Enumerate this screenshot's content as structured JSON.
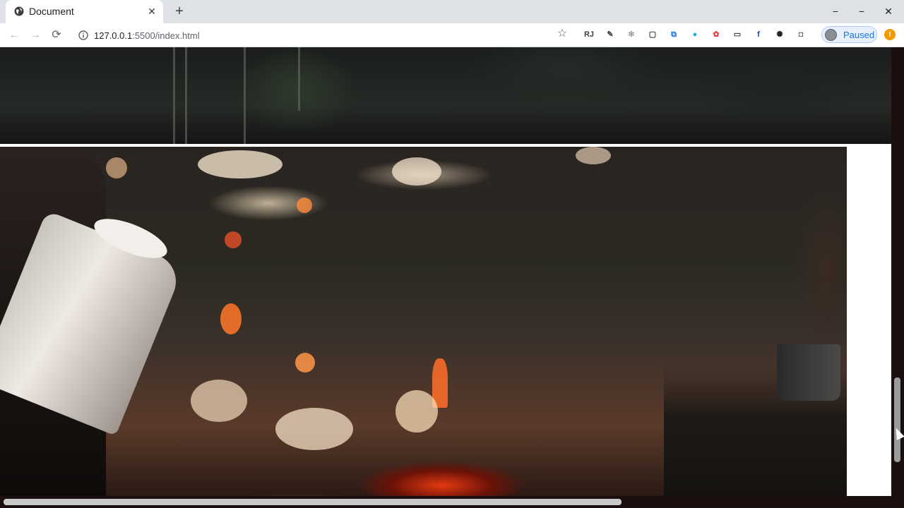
{
  "browser": {
    "tab": {
      "title": "Document",
      "favicon": "globe-icon",
      "close_glyph": "✕"
    },
    "new_tab_glyph": "+",
    "window_controls": {
      "minimize": "−",
      "maximize": "−",
      "close": "✕"
    },
    "nav": {
      "back": "←",
      "forward": "→",
      "reload": "⟳"
    },
    "address": {
      "host": "127.0.0.1",
      "rest": ":5500/index.html",
      "info_icon": "info-icon",
      "star": "☆"
    },
    "extensions": [
      {
        "name": "rj-extension-icon",
        "glyph": "RJ",
        "color": "#3c4043"
      },
      {
        "name": "eyedropper-extension-icon",
        "glyph": "✎",
        "color": "#3c4043"
      },
      {
        "name": "snowflake-extension-icon",
        "glyph": "✻",
        "color": "#9aa0a6"
      },
      {
        "name": "square-extension-icon",
        "glyph": "▢",
        "color": "#3c4043"
      },
      {
        "name": "translate-extension-icon",
        "glyph": "⧉",
        "color": "#1a73e8"
      },
      {
        "name": "blue-dot-extension-icon",
        "glyph": "●",
        "color": "#1ea7e1"
      },
      {
        "name": "color-wheel-extension-icon",
        "glyph": "✿",
        "color": "#e53935"
      },
      {
        "name": "screen-extension-icon",
        "glyph": "▭",
        "color": "#3c4043"
      },
      {
        "name": "f-extension-icon",
        "glyph": "f",
        "color": "#1a3fbf"
      },
      {
        "name": "swirl-extension-icon",
        "glyph": "✺",
        "color": "#202124"
      },
      {
        "name": "camera-extension-icon",
        "glyph": "◘",
        "color": "#5f6368"
      }
    ],
    "profile": {
      "label": "Paused"
    },
    "update_glyph": "!"
  }
}
